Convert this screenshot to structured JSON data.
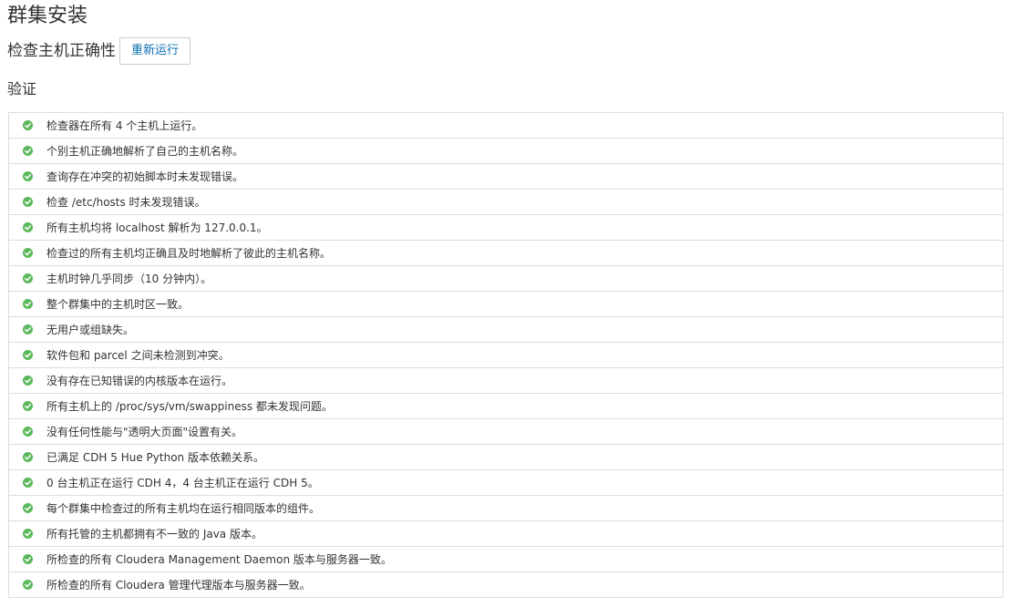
{
  "page": {
    "title": "群集安装"
  },
  "host_check": {
    "heading": "检查主机正确性",
    "rerun_label": "重新运行"
  },
  "validation": {
    "heading": "验证",
    "status_color": "#5cb85c",
    "items": [
      {
        "status": "ok",
        "text": "检查器在所有 4 个主机上运行。"
      },
      {
        "status": "ok",
        "text": "个别主机正确地解析了自己的主机名称。"
      },
      {
        "status": "ok",
        "text": "查询存在冲突的初始脚本时未发现错误。"
      },
      {
        "status": "ok",
        "text": "检查 /etc/hosts 时未发现错误。"
      },
      {
        "status": "ok",
        "text": "所有主机均将 localhost 解析为 127.0.0.1。"
      },
      {
        "status": "ok",
        "text": "检查过的所有主机均正确且及时地解析了彼此的主机名称。"
      },
      {
        "status": "ok",
        "text": "主机时钟几乎同步（10 分钟内）。"
      },
      {
        "status": "ok",
        "text": "整个群集中的主机时区一致。"
      },
      {
        "status": "ok",
        "text": "无用户或组缺失。"
      },
      {
        "status": "ok",
        "text": "软件包和 parcel 之间未检测到冲突。"
      },
      {
        "status": "ok",
        "text": "没有存在已知错误的内核版本在运行。"
      },
      {
        "status": "ok",
        "text": "所有主机上的 /proc/sys/vm/swappiness 都未发现问题。"
      },
      {
        "status": "ok",
        "text": "没有任何性能与\"透明大页面\"设置有关。"
      },
      {
        "status": "ok",
        "text": "已满足 CDH 5 Hue Python 版本依赖关系。"
      },
      {
        "status": "ok",
        "text": "0 台主机正在运行 CDH 4，4 台主机正在运行 CDH 5。"
      },
      {
        "status": "ok",
        "text": "每个群集中检查过的所有主机均在运行相同版本的组件。"
      },
      {
        "status": "ok",
        "text": "所有托管的主机都拥有不一致的 Java 版本。"
      },
      {
        "status": "ok",
        "text": "所检查的所有 Cloudera Management Daemon 版本与服务器一致。"
      },
      {
        "status": "ok",
        "text": "所检查的所有 Cloudera 管理代理版本与服务器一致。"
      }
    ]
  }
}
